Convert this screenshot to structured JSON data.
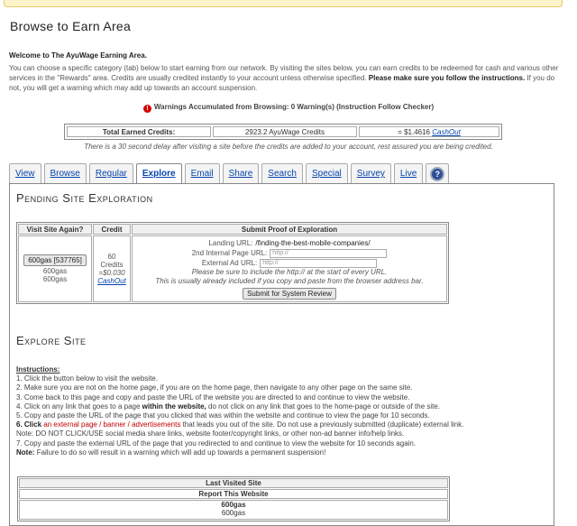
{
  "page": {
    "title": "Browse to Earn Area",
    "welcome": "Welcome to The AyuWage Earning Area.",
    "intro_text": "You can choose a specific category (tab) below to start earning from our network. By visiting the sites below, you can earn credits to be redeemed for cash and various other services in the \"Rewards\" area. Credits are usually credited instantly to your account unless otherwise specified.",
    "intro_bold": "Please make sure you follow the instructions.",
    "intro_tail": "If you do not, you will get a warning which may add up towards an account suspension."
  },
  "warnings": {
    "text": "Warnings Accumulated from Browsing: 0 Warning(s) (Instruction Follow Checker)"
  },
  "credits": {
    "label": "Total Earned Credits:",
    "value": "2923.2 AyuWage Credits",
    "cash": "= $1.4616",
    "cashout": "CashOut",
    "delay_note": "There is a 30 second delay after visiting a site before the credits are added to your account, rest assured you are being credited."
  },
  "tabs": [
    {
      "label": "View"
    },
    {
      "label": "Browse"
    },
    {
      "label": "Regular"
    },
    {
      "label": "Explore"
    },
    {
      "label": "Email"
    },
    {
      "label": "Share"
    },
    {
      "label": "Search"
    },
    {
      "label": "Special"
    },
    {
      "label": "Survey"
    },
    {
      "label": "Live"
    }
  ],
  "help_tab_glyph": "?",
  "pending": {
    "title": "Pending Site Exploration",
    "headers": [
      "Visit Site Again?",
      "Credit",
      "Submit Proof of Exploration"
    ],
    "site_button": "600gas [537765]",
    "site_name_1": "600gas",
    "site_name_2": "600gas",
    "credit_amount": "60 Credits",
    "credit_value": "=$0.030",
    "credit_cashout": "CashOut",
    "landing_label": "Landing URL:",
    "landing_value": "/finding-the-best-mobile-companies/",
    "internal_label": "2nd Internal Page URL:",
    "internal_placeholder": "http://",
    "external_label": "External Ad URL:",
    "external_placeholder": "http://",
    "note_1": "Please be sure to include the http:// at the start of every URL.",
    "note_2": "This is usually already included if you copy and paste from the browser address bar.",
    "submit_label": "Submit for System Review"
  },
  "explore": {
    "title": "Explore Site",
    "instructions_head": "Instructions:",
    "step_1": "1. Click the button below to visit the website.",
    "step_2": "2. Make sure you are not on the home page, if you are on the home page, then navigate to any other page on the same site.",
    "step_3": "3. Come back to this page and copy and paste the URL of the website you are directed to and continue to view the website.",
    "step_4_a": "4. Click on any link that goes to a page",
    "step_4_b": "within the website,",
    "step_4_c": "do not click on any link that goes to the home-page or outside of the site.",
    "step_5": "5. Copy and paste the URL of the page that you clicked that was within the website and continue to view the page for 10 seconds.",
    "step_6_a": "6. Click",
    "step_6_b": "an external page / banner / advertisements",
    "step_6_c": "that leads you out of the site. Do not use a previously submitted (duplicate) external link.",
    "note_social": "Note: DO NOT CLICK/USE social media share links, website footer/copyright links, or other non-ad banner info/help links.",
    "step_7": "7. Copy and paste the external URL of the page that you redirected to and continue to view the website for 10 seconds again.",
    "note_label": "Note:",
    "note_text": "Failure to do so will result in a warning which will add up towards a permanent suspension!"
  },
  "last_visited": {
    "header": "Last Visited Site",
    "report": "Report This Website",
    "site_1": "600gas",
    "site_2": "600gas"
  }
}
